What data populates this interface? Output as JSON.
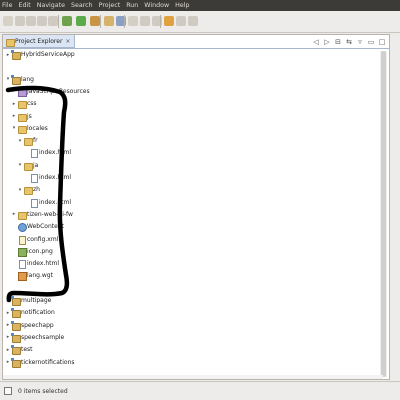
{
  "menubar": {
    "items": [
      "File",
      "Edit",
      "Navigate",
      "Search",
      "Project",
      "Run",
      "Window",
      "Help"
    ]
  },
  "view": {
    "tab_label": "Project Explorer",
    "close_glyph": "×"
  },
  "tree": {
    "rows": [
      {
        "label": "HybridServiceApp",
        "depth": 0,
        "icon": "project",
        "toggle": "▸"
      },
      {
        "label": "",
        "depth": 0,
        "icon": "",
        "toggle": ""
      },
      {
        "label": "lang",
        "depth": 0,
        "icon": "project",
        "toggle": "▾"
      },
      {
        "label": "JavaScript Resources",
        "depth": 1,
        "icon": "jsres",
        "toggle": "▸"
      },
      {
        "label": "css",
        "depth": 1,
        "icon": "folder",
        "toggle": "▸"
      },
      {
        "label": "js",
        "depth": 1,
        "icon": "folder",
        "toggle": "▸"
      },
      {
        "label": "locales",
        "depth": 1,
        "icon": "folder",
        "toggle": "▾"
      },
      {
        "label": "fr",
        "depth": 2,
        "icon": "folder",
        "toggle": "▾"
      },
      {
        "label": "index.html",
        "depth": 3,
        "icon": "file",
        "toggle": ""
      },
      {
        "label": "ja",
        "depth": 2,
        "icon": "folder",
        "toggle": "▾"
      },
      {
        "label": "index.html",
        "depth": 3,
        "icon": "file",
        "toggle": ""
      },
      {
        "label": "zh",
        "depth": 2,
        "icon": "folder",
        "toggle": "▾"
      },
      {
        "label": "index.html",
        "depth": 3,
        "icon": "file",
        "toggle": ""
      },
      {
        "label": "tizen-web-ui-fw",
        "depth": 1,
        "icon": "folder",
        "toggle": "▸"
      },
      {
        "label": "WebContent",
        "depth": 1,
        "icon": "globe",
        "toggle": ""
      },
      {
        "label": "config.xml",
        "depth": 1,
        "icon": "xml",
        "toggle": ""
      },
      {
        "label": "icon.png",
        "depth": 1,
        "icon": "img",
        "toggle": ""
      },
      {
        "label": "index.html",
        "depth": 1,
        "icon": "file",
        "toggle": ""
      },
      {
        "label": "lang.wgt",
        "depth": 1,
        "icon": "wgt",
        "toggle": ""
      },
      {
        "label": "",
        "depth": 0,
        "icon": "",
        "toggle": ""
      },
      {
        "label": "multipage",
        "depth": 0,
        "icon": "project",
        "toggle": "▸"
      },
      {
        "label": "notification",
        "depth": 0,
        "icon": "project",
        "toggle": "▸"
      },
      {
        "label": "speechapp",
        "depth": 0,
        "icon": "project",
        "toggle": "▸"
      },
      {
        "label": "speechsample",
        "depth": 0,
        "icon": "project",
        "toggle": "▸"
      },
      {
        "label": "test",
        "depth": 0,
        "icon": "project",
        "toggle": "▸"
      },
      {
        "label": "tickernotifications",
        "depth": 0,
        "icon": "project",
        "toggle": "▸"
      }
    ]
  },
  "status": {
    "text": "0 items selected"
  },
  "colors": {
    "menubar_bg": "#3c3b37",
    "scribble": "#000000"
  }
}
